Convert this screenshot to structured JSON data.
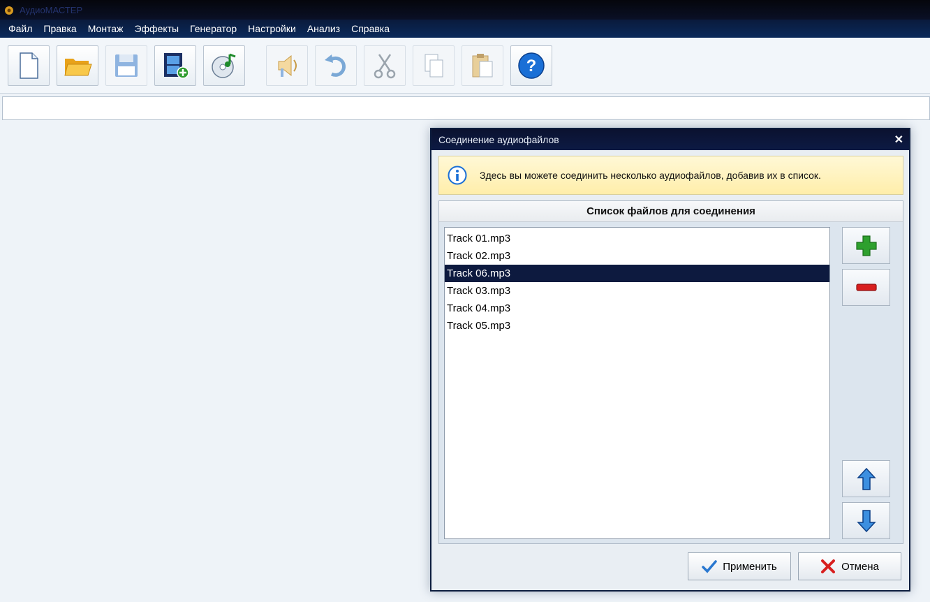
{
  "window": {
    "title": "АудиоМАСТЕР"
  },
  "menu": [
    "Файл",
    "Правка",
    "Монтаж",
    "Эффекты",
    "Генератор",
    "Настройки",
    "Анализ",
    "Справка"
  ],
  "toolbar": {
    "new": "new-file-icon",
    "open": "open-folder-icon",
    "save": "save-icon",
    "video": "add-video-icon",
    "cd": "cd-music-icon",
    "sound": "sound-icon",
    "undo": "undo-icon",
    "cut": "cut-icon",
    "copy": "copy-icon",
    "paste": "paste-icon",
    "help": "help-icon"
  },
  "dialog": {
    "title": "Соединение аудиофайлов",
    "close": "✕",
    "info_text": "Здесь вы можете соединить несколько аудиофайлов, добавив их в список.",
    "list_header": "Список файлов для соединения",
    "files": [
      "Track 01.mp3",
      "Track 02.mp3",
      "Track 06.mp3",
      "Track 03.mp3",
      "Track 04.mp3",
      "Track 05.mp3"
    ],
    "selected_file": "Track 06.mp3",
    "apply_label": "Применить",
    "cancel_label": "Отмена"
  },
  "colors": {
    "accent_dark": "#0d1a3f",
    "info_bg": "#fff3c0",
    "add": "#2ea02e",
    "remove": "#d81e1e"
  }
}
